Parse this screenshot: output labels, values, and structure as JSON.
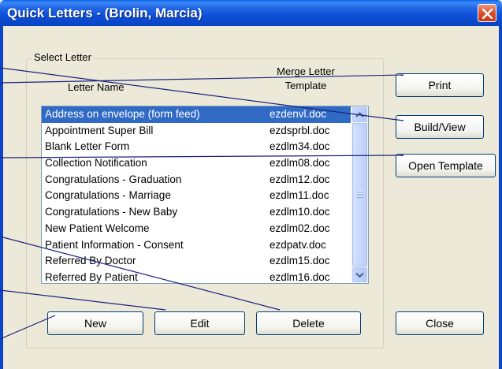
{
  "window": {
    "title": "Quick Letters - (Brolin, Marcia)"
  },
  "group": {
    "label": "Select Letter"
  },
  "columns": {
    "name_header": "Letter Name",
    "template_header_line1": "Merge Letter",
    "template_header_line2": "Template"
  },
  "letters": [
    {
      "name": "Address on envelope (form feed)",
      "template": "ezdenvl.doc",
      "selected": true
    },
    {
      "name": "Appointment Super Bill",
      "template": "ezdsprbl.doc"
    },
    {
      "name": "Blank Letter Form",
      "template": "ezdlm34.doc"
    },
    {
      "name": "Collection Notification",
      "template": "ezdlm08.doc"
    },
    {
      "name": "Congratulations - Graduation",
      "template": "ezdlm12.doc"
    },
    {
      "name": "Congratulations - Marriage",
      "template": "ezdlm11.doc"
    },
    {
      "name": "Congratulations - New Baby",
      "template": "ezdlm10.doc"
    },
    {
      "name": "New Patient Welcome",
      "template": "ezdlm02.doc"
    },
    {
      "name": "Patient Information - Consent",
      "template": "ezdpatv.doc"
    },
    {
      "name": "Referred By Doctor",
      "template": "ezdlm15.doc"
    },
    {
      "name": "Referred By Patient",
      "template": "ezdlm16.doc"
    }
  ],
  "buttons": {
    "print": "Print",
    "build_view": "Build/View",
    "open_template": "Open Template",
    "close": "Close",
    "new": "New",
    "edit": "Edit",
    "delete": "Delete"
  },
  "colors": {
    "titlebar": "#0844c5",
    "selection": "#316ac5",
    "callout_line": "#1a237e",
    "window_bg": "#ece9d8"
  }
}
